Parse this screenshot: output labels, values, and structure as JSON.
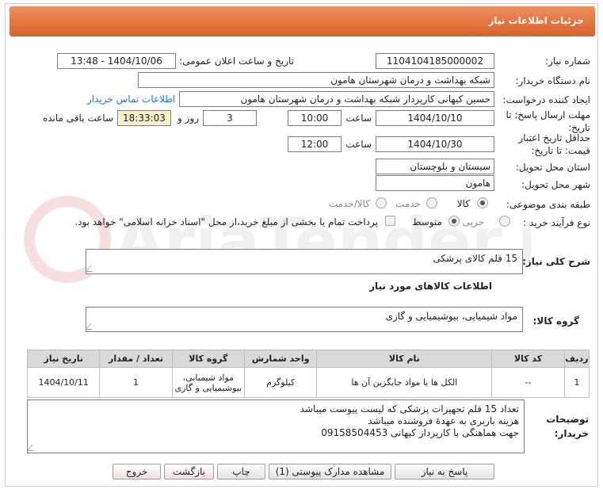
{
  "header": {
    "title": "جزئیات اطلاعات نیاز"
  },
  "fields": {
    "need_number_label": "شماره نیاز:",
    "need_number": "1104104185000002",
    "announce_label": "تاریخ و ساعت اعلان عمومی:",
    "announce_value": "1404/10/06 - 13:48",
    "buyer_label": "نام دستگاه خریدار:",
    "buyer_value": "شبکه بهداشت و درمان شهرستان هامون",
    "creator_label": "ایجاد کننده درخواست:",
    "creator_value": "حسین کیهانی کارپرداز شبکه بهداشت و درمان شهرستان هامون",
    "contact_link": "اطلاعات تماس خریدار",
    "deadline_label": "مهلت ارسال پاسخ: تا تاریخ:",
    "deadline_date": "1404/10/10",
    "time_label": "ساعت",
    "deadline_time": "10:00",
    "days_value": "3",
    "days_label": "روز و",
    "remaining_value": "18:33:03",
    "remaining_label": "ساعت باقی مانده",
    "validity_label": "حداقل تاریخ اعتبار قیمت: تا تاریخ:",
    "validity_date": "1404/10/30",
    "validity_time": "12:00",
    "province_label": "استان محل تحویل:",
    "province_value": "سیستان و بلوچستان",
    "city_label": "شهر محل تحویل:",
    "city_value": "هامون",
    "category_label": "طبقه بندی موضوعی:",
    "cat_goods": "کالا",
    "cat_service": "خدمت",
    "cat_goods_service": "کالا/خدمت",
    "process_label": "نوع فرآیند خرید :",
    "proc_minor": "جزیی",
    "proc_medium": "متوسط",
    "proc_note": "پرداخت تمام یا بخشی از مبلغ خرید،از محل \"اسناد خزانه اسلامی\" خواهد بود."
  },
  "summary": {
    "label": "شرح کلی نیاز:",
    "value": "15 قلم کالای پزشکی"
  },
  "goods_info_title": "اطلاعات کالاهای مورد نیاز",
  "goods_group": {
    "label": "گروه کالا:",
    "value": "مواد شیمیایی، بیوشیمیایی و  گازی"
  },
  "table": {
    "headers": [
      "ردیف",
      "کد کالا",
      "نام کالا",
      "واحد شمارش",
      "گروه کالا",
      "تعداد / مقدار",
      "تاریخ نیاز"
    ],
    "rows": [
      [
        "1",
        "--",
        "الکل ها یا مواد جایگزین آن ها",
        "کیلوگرم",
        "مواد شیمیایی، بیوشیمیایی و گازی",
        "1",
        "1404/10/11"
      ]
    ]
  },
  "notes": {
    "label": "توضیحات خریدار:",
    "lines": [
      "تعداد 15 قلم تجهیزات پزشکی که لیست پیوست میباشد",
      "هزینه باربری به عهدهٔ فروشنده میباشد",
      "جهت هماهنگی با کارپرداز کیهانی 09158504453"
    ]
  },
  "buttons": {
    "reply": "پاسخ به نیاز",
    "attachments": "مشاهده مدارک پیوستی (1)",
    "print": "چاپ",
    "back": "بازگشت",
    "exit": "خروج"
  },
  "watermark": "AriaTender.net",
  "colors": {
    "header": "#d9622c",
    "link": "#1976d2",
    "remaining_bg": "#f8f0c8"
  }
}
